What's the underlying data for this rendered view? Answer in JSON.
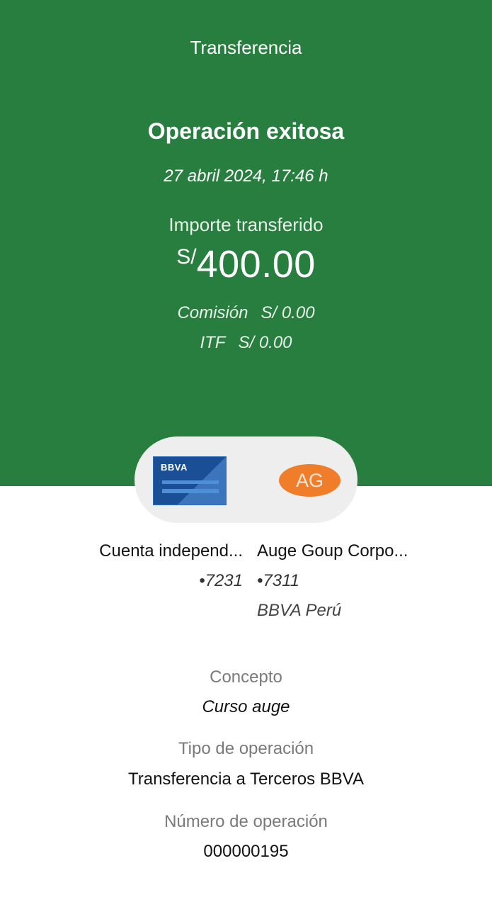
{
  "header": {
    "title": "Transferencia"
  },
  "status": "Operación exitosa",
  "datetime": "27 abril 2024,  17:46 h",
  "amount": {
    "label": "Importe transferido",
    "currency": "S/",
    "value": "400.00"
  },
  "fees": {
    "commission_label": "Comisión",
    "commission_value": "S/ 0.00",
    "itf_label": "ITF",
    "itf_value": "S/ 0.00"
  },
  "transfer": {
    "card_logo": "BBVA",
    "avatar_initials": "AG",
    "colors": {
      "green": "#277e3f",
      "card_blue": "#1a4f96",
      "avatar_orange": "#ef7d2a"
    },
    "from": {
      "name": "Cuenta independ...",
      "number": "•7231"
    },
    "to": {
      "name": "Auge Goup Corpo...",
      "number": "•7311",
      "bank": "BBVA Perú"
    }
  },
  "details": {
    "concept_label": "Concepto",
    "concept_value": "Curso auge",
    "type_label": "Tipo de operación",
    "type_value": "Transferencia a Terceros BBVA",
    "number_label": "Número de operación",
    "number_value": "000000195"
  }
}
